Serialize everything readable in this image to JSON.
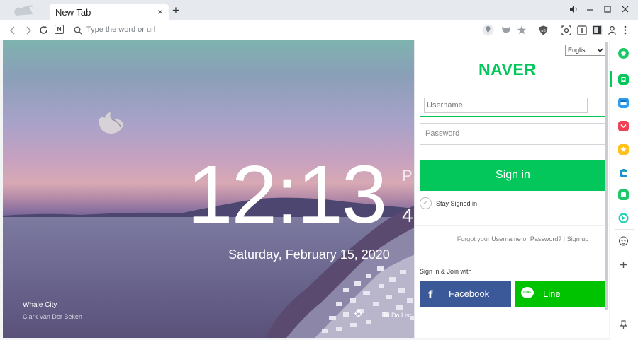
{
  "browser": {
    "tab_title": "New Tab",
    "tab_close": "×",
    "new_tab": "+",
    "address_placeholder": "Type the word or url",
    "n_badge": "N",
    "icons": [
      "back-icon",
      "forward-icon",
      "reload-icon",
      "naver-n-icon",
      "search-icon",
      "location-icon",
      "shield-icon",
      "star-icon",
      "ublock-icon",
      "capture-icon",
      "reader-icon",
      "sidebar-toggle-icon",
      "profile-icon",
      "menu-icon"
    ]
  },
  "newtab": {
    "clock": "12:13",
    "ampm": "P",
    "seconds": "4",
    "date": "Saturday, February 15, 2020",
    "photo_title": "Whale City",
    "photo_author": "Clark Van Der Beken",
    "todo": "To Do List"
  },
  "panel": {
    "language": "English",
    "brand": "NAVER",
    "username_placeholder": "Username",
    "password_placeholder": "Password",
    "signin": "Sign in",
    "stay": "Stay Signed in",
    "forgot_prefix": "Forgot your",
    "forgot_username": "Username",
    "forgot_or": "or",
    "forgot_password": "Password?",
    "signup": "Sign up",
    "join_with": "Sign in & Join with",
    "facebook": "Facebook",
    "line": "Line",
    "line_badge": "LINE"
  },
  "colors": {
    "naver_green": "#03c75a",
    "facebook_blue": "#3b5998",
    "line_green": "#00c300"
  }
}
